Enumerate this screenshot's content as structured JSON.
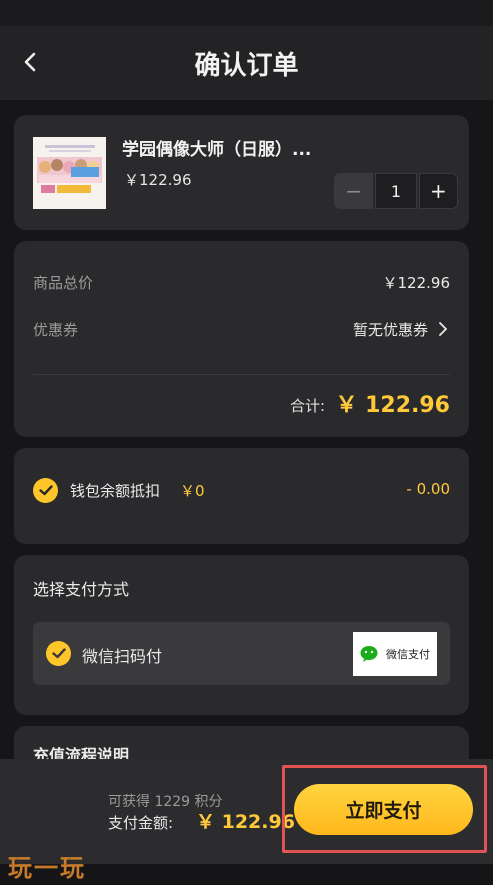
{
  "header": {
    "title": "确认订单",
    "back_icon": "chevron-left-icon"
  },
  "product": {
    "name": "学园偶像大师（日服）...",
    "price": "￥122.96",
    "quantity": "1",
    "minus_label": "−",
    "plus_label": "+"
  },
  "summary": {
    "subtotal_label": "商品总价",
    "subtotal_value": "￥122.96",
    "coupon_label": "优惠券",
    "coupon_value": "暂无优惠券",
    "total_label": "合计:",
    "total_value": "￥ 122.96"
  },
  "wallet": {
    "label": "钱包余额抵扣",
    "balance": "￥0",
    "deduction": "- 0.00"
  },
  "payment": {
    "section_title": "选择支付方式",
    "option_label": "微信扫码付",
    "logo_text": "微信支付"
  },
  "info": {
    "title": "充值流程说明"
  },
  "bottom": {
    "points": "可获得 1229 积分",
    "pay_label": "支付金额:",
    "pay_amount": "￥ 122.96",
    "pay_button": "立即支付"
  },
  "watermark": "玩一玩",
  "colors": {
    "accent": "#ffc62a",
    "price": "#ffc93a",
    "background": "#161618",
    "card": "#2a2a2d",
    "highlight_border": "#e15454",
    "wechat_green": "#1aad19"
  }
}
